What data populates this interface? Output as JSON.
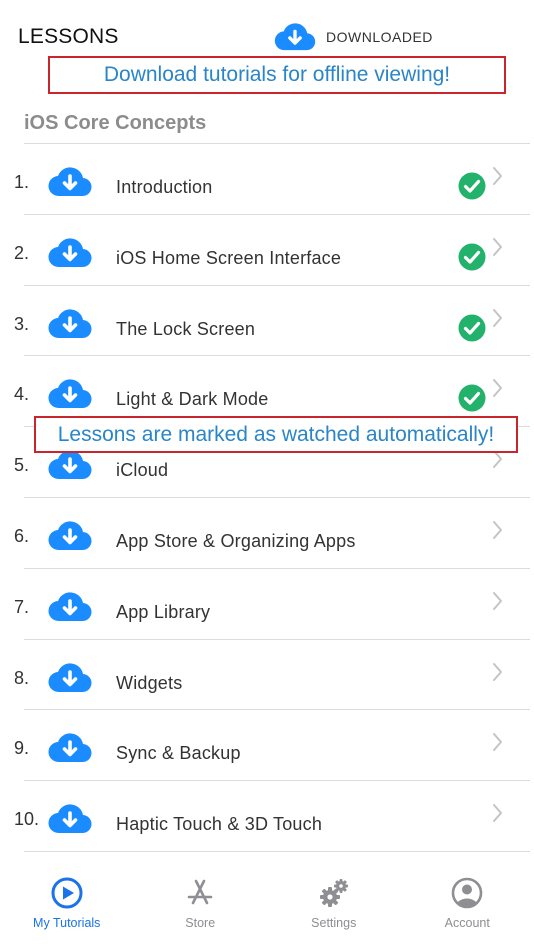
{
  "header": {
    "title": "LESSONS",
    "downloaded_label": "DOWNLOADED"
  },
  "callouts": {
    "top": "Download tutorials for offline viewing!",
    "middle": "Lessons are marked as watched automatically!"
  },
  "section": {
    "title": "iOS Core Concepts"
  },
  "lessons": [
    {
      "number": "1.",
      "title": "Introduction",
      "watched": true
    },
    {
      "number": "2.",
      "title": "iOS Home Screen Interface",
      "watched": true
    },
    {
      "number": "3.",
      "title": "The Lock Screen",
      "watched": true
    },
    {
      "number": "4.",
      "title": "Light & Dark Mode",
      "watched": true
    },
    {
      "number": "5.",
      "title": "iCloud",
      "watched": false
    },
    {
      "number": "6.",
      "title": "App Store & Organizing Apps",
      "watched": false
    },
    {
      "number": "7.",
      "title": "App Library",
      "watched": false
    },
    {
      "number": "8.",
      "title": "Widgets",
      "watched": false
    },
    {
      "number": "9.",
      "title": "Sync & Backup",
      "watched": false
    },
    {
      "number": "10.",
      "title": "Haptic Touch & 3D Touch",
      "watched": false
    }
  ],
  "tab_bar": [
    {
      "label": "My Tutorials",
      "icon": "play-circle-icon",
      "active": true
    },
    {
      "label": "Store",
      "icon": "app-store-icon",
      "active": false
    },
    {
      "label": "Settings",
      "icon": "gears-icon",
      "active": false
    },
    {
      "label": "Account",
      "icon": "account-icon",
      "active": false
    }
  ],
  "colors": {
    "accent": "#1a73e8",
    "cloud_blue": "#1a8cff",
    "check_green": "#22b26b",
    "callout_border": "#c8252c",
    "callout_text": "#2a85c8"
  }
}
